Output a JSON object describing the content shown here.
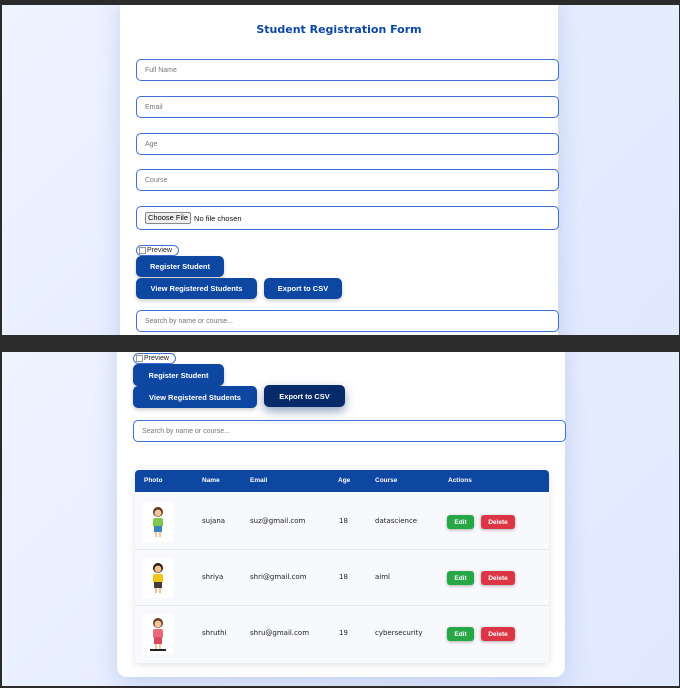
{
  "form": {
    "title": "Student Registration Form",
    "full_name_placeholder": "Full Name",
    "email_placeholder": "Email",
    "age_placeholder": "Age",
    "course_placeholder": "Course",
    "file_button_label": "Choose File",
    "file_status": "No file chosen",
    "preview_alt": "Preview",
    "register_label": "Register Student",
    "view_label": "View Registered Students",
    "export_label": "Export to CSV",
    "search_placeholder": "Search by name or course..."
  },
  "table": {
    "headers": [
      "Photo",
      "Name",
      "Email",
      "Age",
      "Course",
      "Actions"
    ],
    "rows": [
      {
        "name": "sujana",
        "email": "suz@gmail.com",
        "age": "18",
        "course": "datascience",
        "photo_icon": "student-avatar-icon"
      },
      {
        "name": "shriya",
        "email": "shri@gmail.com",
        "age": "18",
        "course": "aiml",
        "photo_icon": "student-avatar-icon"
      },
      {
        "name": "shruthi",
        "email": "shru@gmail.com",
        "age": "19",
        "course": "cybersecurity",
        "photo_icon": "student-avatar-icon"
      }
    ],
    "edit_label": "Edit",
    "delete_label": "Delete"
  },
  "colors": {
    "primary": "#0d47a1",
    "edit": "#28a745",
    "delete": "#dc3545"
  }
}
